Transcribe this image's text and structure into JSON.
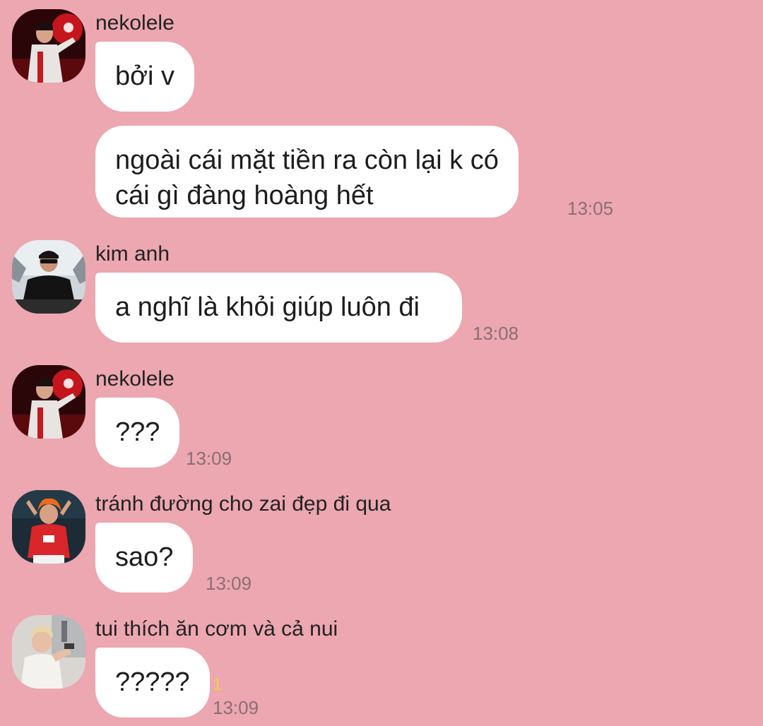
{
  "colors": {
    "background": "#eca7b1",
    "bubble": "#ffffff",
    "time": "#8a6f74",
    "unread": "#f0d24a"
  },
  "messages": [
    {
      "sender": "nekolele",
      "avatar": "avatar-nekolele",
      "bubbles": [
        {
          "lines": [
            "bởi v"
          ]
        },
        {
          "lines": [
            "ngoài cái mặt tiền ra còn lại k có",
            "cái gì đàng hoàng hết"
          ],
          "time": "13:05"
        }
      ]
    },
    {
      "sender": "kim anh",
      "avatar": "avatar-kim-anh",
      "bubbles": [
        {
          "lines": [
            "a nghĩ là khỏi giúp luôn đi"
          ],
          "time": "13:08"
        }
      ]
    },
    {
      "sender": "nekolele",
      "avatar": "avatar-nekolele",
      "bubbles": [
        {
          "lines": [
            "???"
          ],
          "time": "13:09"
        }
      ]
    },
    {
      "sender": "tránh đường cho zai đẹp đi qua",
      "avatar": "avatar-orange-hair",
      "bubbles": [
        {
          "lines": [
            "sao?"
          ],
          "time": "13:09"
        }
      ]
    },
    {
      "sender": "tui thích ăn cơm và cả nui",
      "avatar": "avatar-blonde",
      "bubbles": [
        {
          "lines": [
            "?????"
          ],
          "time": "13:09",
          "unread": "1"
        }
      ]
    }
  ]
}
